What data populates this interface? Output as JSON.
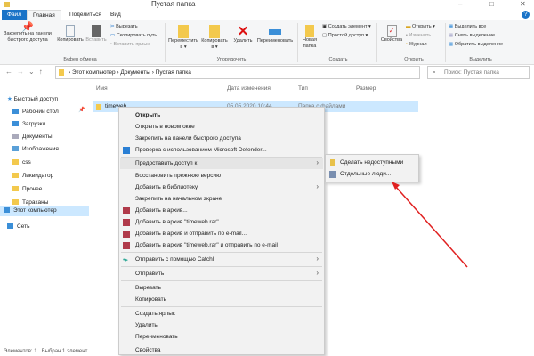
{
  "window": {
    "title": "Пустая папка"
  },
  "tabs": [
    "Файл",
    "Главная",
    "Поделиться",
    "Вид"
  ],
  "ribbon": {
    "pin": "Закрепить на панели быстрого доступа",
    "copy": "Копировать",
    "paste": "Вставить",
    "cut": "Вырезать",
    "copy_path": "Скопировать путь",
    "paste_shortcut": "Вставить ярлык",
    "clipboard": "Буфер обмена",
    "move_to": "Переместить в",
    "copy_to": "Копировать в",
    "delete": "Удалить",
    "rename": "Переименовать",
    "organize": "Упорядочить",
    "new_folder": "Новая папка",
    "new_item": "Создать элемент",
    "easy_access": "Простой доступ",
    "create": "Создать",
    "properties": "Свойства",
    "open": "Открыть",
    "edit": "Изменить",
    "history": "Журнал",
    "open_group": "Открыть",
    "select_all": "Выделить все",
    "select_none": "Снять выделение",
    "invert": "Обратить выделение",
    "select": "Выделить"
  },
  "address": {
    "path": [
      "Этот компьютер",
      "Документы",
      "Пустая папка"
    ],
    "search_placeholder": "Поиск: Пустая папка"
  },
  "sidebar": [
    "Быстрый доступ",
    "Рабочий стол",
    "Загрузки",
    "Документы",
    "Изображения",
    "css",
    "Ликвидатор",
    "Прочее",
    "Тараканы",
    "Этот компьютер",
    "Сеть"
  ],
  "columns": [
    "Имя",
    "Дата изменения",
    "Тип",
    "Размер"
  ],
  "file": {
    "name": "timeweb",
    "date": "05.05.2020 10:44",
    "type": "Папка с файлами"
  },
  "context_menu": [
    "Открыть",
    "Открыть в новом окне",
    "Закрепить на панели быстрого доступа",
    "Проверка с использованием Microsoft Defender...",
    "Предоставить доступ к",
    "Восстановить прежнюю версию",
    "Добавить в библиотеку",
    "Закрепить на начальном экране",
    "Добавить в архив...",
    "Добавить в архив \"timeweb.rar\"",
    "Добавить в архив и отправить по e-mail...",
    "Добавить в архив \"timeweb.rar\" и отправить по e-mail",
    "Отправить с помощью Catchl",
    "Отправить",
    "Вырезать",
    "Копировать",
    "Создать ярлык",
    "Удалить",
    "Переименовать",
    "Свойства"
  ],
  "submenu": [
    "Сделать недоступными",
    "Отдельные люди..."
  ],
  "status": {
    "count": "Элементов: 1",
    "selected": "Выбран 1 элемент"
  },
  "colors": {
    "accent": "#1a73c7",
    "selection": "#cce8ff",
    "arrow": "#e02020"
  }
}
